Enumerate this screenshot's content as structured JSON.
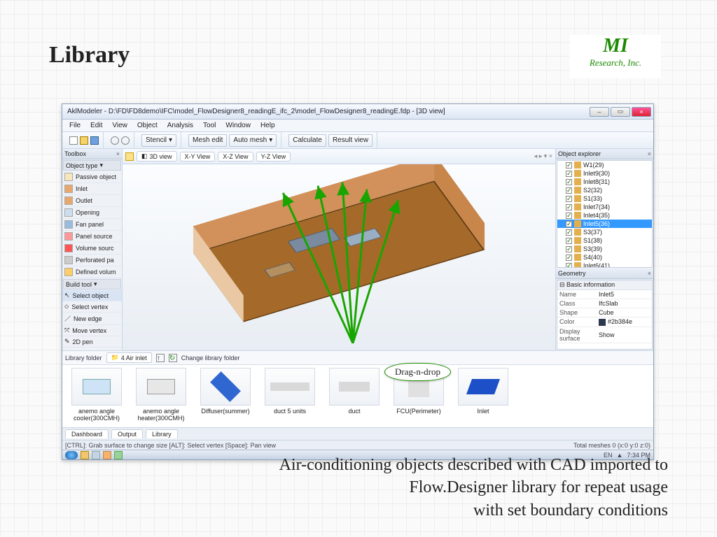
{
  "slide": {
    "title": "Library",
    "logo_main": "MI",
    "logo_sub": "Research, Inc.",
    "caption_l1": "Air-conditioning objects described with CAD imported to",
    "caption_l2": "Flow.Designer library for repeat usage",
    "caption_l3": "with set boundary conditions",
    "callout": "Drag-n-drop"
  },
  "app": {
    "title": "AklModeler - D:\\FD\\FD8demo\\IFC\\model_FlowDesigner8_readingE_ifc_2\\model_FlowDesigner8_readingE.fdp - [3D view]",
    "menu": [
      "File",
      "Edit",
      "View",
      "Object",
      "Analysis",
      "Tool",
      "Window",
      "Help"
    ],
    "toolbar": {
      "stencil": "Stencil",
      "mesh_edit": "Mesh edit",
      "auto_mesh": "Auto mesh",
      "calculate": "Calculate",
      "result_view": "Result view"
    },
    "view_tabs": [
      "3D view",
      "X-Y View",
      "X-Z View",
      "Y-Z View"
    ],
    "toolbox": {
      "title": "Toolbox",
      "sec1": "Object type",
      "passive": "Passive object",
      "items1": [
        "Inlet",
        "Outlet",
        "Opening",
        "Fan panel",
        "Panel source",
        "Volume sourc",
        "Perforated pa",
        "Defined volum"
      ],
      "sec2": "Build tool",
      "items2": [
        "Select object",
        "Select vertex",
        "New edge",
        "Move vertex",
        "2D pen"
      ]
    },
    "explorer": {
      "title": "Object explorer",
      "items": [
        {
          "label": "W1(29)",
          "sel": false
        },
        {
          "label": "Inlet9(30)",
          "sel": false
        },
        {
          "label": "Inlet8(31)",
          "sel": false
        },
        {
          "label": "S2(32)",
          "sel": false
        },
        {
          "label": "S1(33)",
          "sel": false
        },
        {
          "label": "Inlet7(34)",
          "sel": false
        },
        {
          "label": "Inlet4(35)",
          "sel": false
        },
        {
          "label": "Inlet5(36)",
          "sel": true
        },
        {
          "label": "S3(37)",
          "sel": false
        },
        {
          "label": "S1(38)",
          "sel": false
        },
        {
          "label": "S3(39)",
          "sel": false
        },
        {
          "label": "S4(40)",
          "sel": false
        },
        {
          "label": "Inlet6(41)",
          "sel": false
        }
      ]
    },
    "geometry": {
      "title": "Geometry",
      "section": "Basic information",
      "rows": [
        {
          "k": "Name",
          "v": "Inlet5"
        },
        {
          "k": "Class",
          "v": "IfcSlab"
        },
        {
          "k": "Shape",
          "v": "Cube"
        },
        {
          "k": "Color",
          "v": "#2b384e"
        },
        {
          "k": "Display surface",
          "v": "Show"
        }
      ]
    },
    "library": {
      "title": "Library",
      "folder_label": "Library folder",
      "folder_value": "4 Air inlet",
      "change_label": "Change library folder",
      "items": [
        "anemo angle cooler(300CMH)",
        "anemo angle heater(300CMH)",
        "Diffuser(summer)",
        "duct 5 units",
        "duct",
        "FCU(Perimeter)",
        "Inlet"
      ],
      "bottom_tabs": [
        "Dashboard",
        "Output",
        "Library"
      ]
    },
    "status_left": "[CTRL]: Grab surface to change size [ALT]: Select vertex [Space]: Pan view",
    "status_right": "Total meshes 0 (x:0 y:0 z:0)",
    "taskbar_lang": "EN",
    "taskbar_time": "7:34 PM"
  }
}
